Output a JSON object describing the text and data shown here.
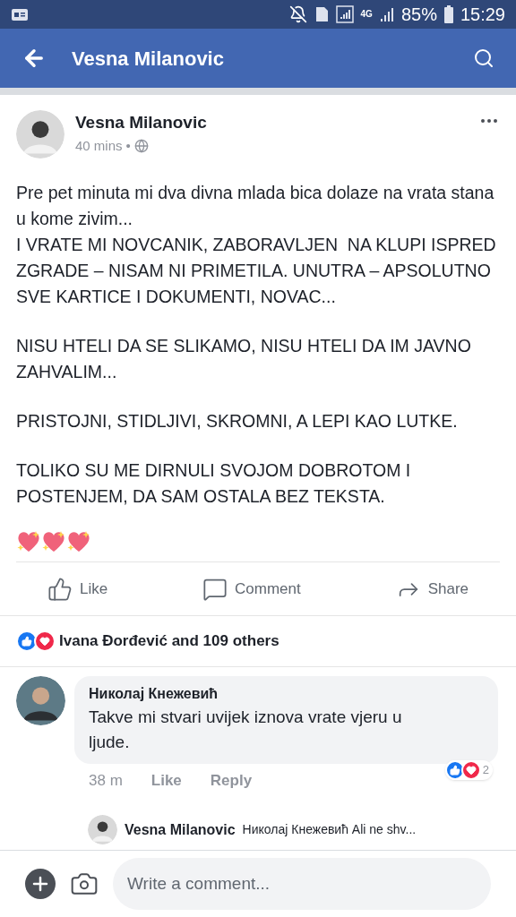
{
  "status_bar": {
    "network": "4G",
    "battery": "85%",
    "time": "15:29"
  },
  "header": {
    "title": "Vesna Milanovic"
  },
  "post": {
    "author": "Vesna Milanovic",
    "time": "40 mins",
    "dot": "•",
    "paragraphs": [
      [
        "Pre pet minuta mi dva divna mlada bica dolaze na vrata stana u kome zivim...",
        "I VRATE MI NOVCANIK, ZABORAVLJEN  NA KLUPI ISPRED ZGRADE – NISAM NI PRIMETILA. UNUTRA – APSOLUTNO SVE KARTICE I DOKUMENTI, NOVAC..."
      ],
      [
        "NISU HTELI DA SE SLIKAMO, NISU HTELI DA IM JAVNO ZAHVALIM..."
      ],
      [
        "PRISTOJNI, STIDLJIVI, SKROMNI, A LEPI KAO LUTKE."
      ],
      [
        "TOLIKO SU ME DIRNULI SVOJOM DOBROTOM I POSTENJEM, DA SAM OSTALA BEZ TEKSTA."
      ]
    ],
    "actions": [
      {
        "kind": "like",
        "label": "Like"
      },
      {
        "kind": "comment",
        "label": "Comment"
      },
      {
        "kind": "share",
        "label": "Share"
      }
    ],
    "reactions_summary": "Ivana Đorđević and 109 others"
  },
  "comments": [
    {
      "author": "Николај Кнежевић",
      "text": "Takve mi stvari uvijek iznova vrate vjeru u ljude.",
      "time": "38 m",
      "like": "Like",
      "reply": "Reply",
      "reaction_count": "2"
    }
  ],
  "reply_preview": {
    "author": "Vesna Milanovic",
    "text": "Николај Кнежевић Ali ne shv..."
  },
  "composer": {
    "placeholder": "Write a comment..."
  }
}
